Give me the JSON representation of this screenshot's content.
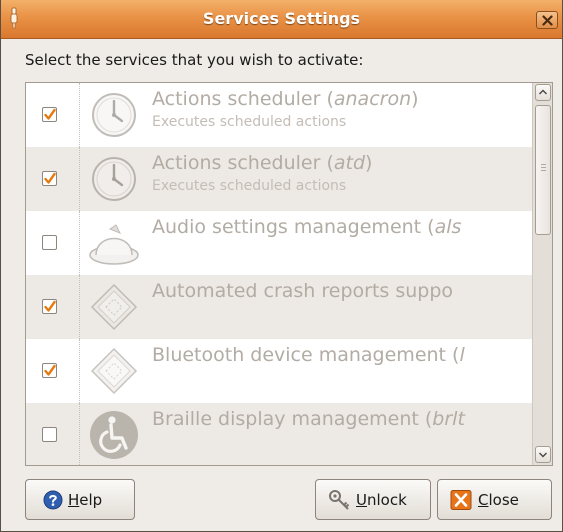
{
  "window": {
    "title": "Services Settings"
  },
  "prompt": "Select the services that you wish to activate:",
  "services": [
    {
      "name_plain": "Actions scheduler (",
      "name_italic": "anacron",
      "name_tail": ")",
      "description": "Executes scheduled actions",
      "checked": true,
      "icon": "clock-icon"
    },
    {
      "name_plain": "Actions scheduler (",
      "name_italic": "atd",
      "name_tail": ")",
      "description": "Executes scheduled actions",
      "checked": true,
      "icon": "clock-icon"
    },
    {
      "name_plain": "Audio settings management (",
      "name_italic": "als",
      "name_tail": "",
      "description": "",
      "checked": false,
      "icon": "volume-knob-icon"
    },
    {
      "name_plain": "Automated crash reports suppo",
      "name_italic": "",
      "name_tail": "",
      "description": "",
      "checked": true,
      "icon": "generic-service-icon"
    },
    {
      "name_plain": "Bluetooth device management (",
      "name_italic": "l",
      "name_tail": "",
      "description": "",
      "checked": true,
      "icon": "generic-service-icon"
    },
    {
      "name_plain": "Braille display management (",
      "name_italic": "brlt",
      "name_tail": "",
      "description": "",
      "checked": false,
      "icon": "accessibility-icon"
    }
  ],
  "scrollbar": {
    "position": 0.0
  },
  "buttons": {
    "help": {
      "mnemonic": "H",
      "rest": "elp"
    },
    "unlock": {
      "mnemonic": "U",
      "rest": "nlock"
    },
    "close": {
      "mnemonic": "C",
      "rest": "lose"
    }
  },
  "colors": {
    "titlebar": "#e99246",
    "row_alt": "#ede9e4",
    "checkmark": "#e07c12",
    "close_icon": "#e8741a",
    "help_icon": "#2f5fb0"
  }
}
